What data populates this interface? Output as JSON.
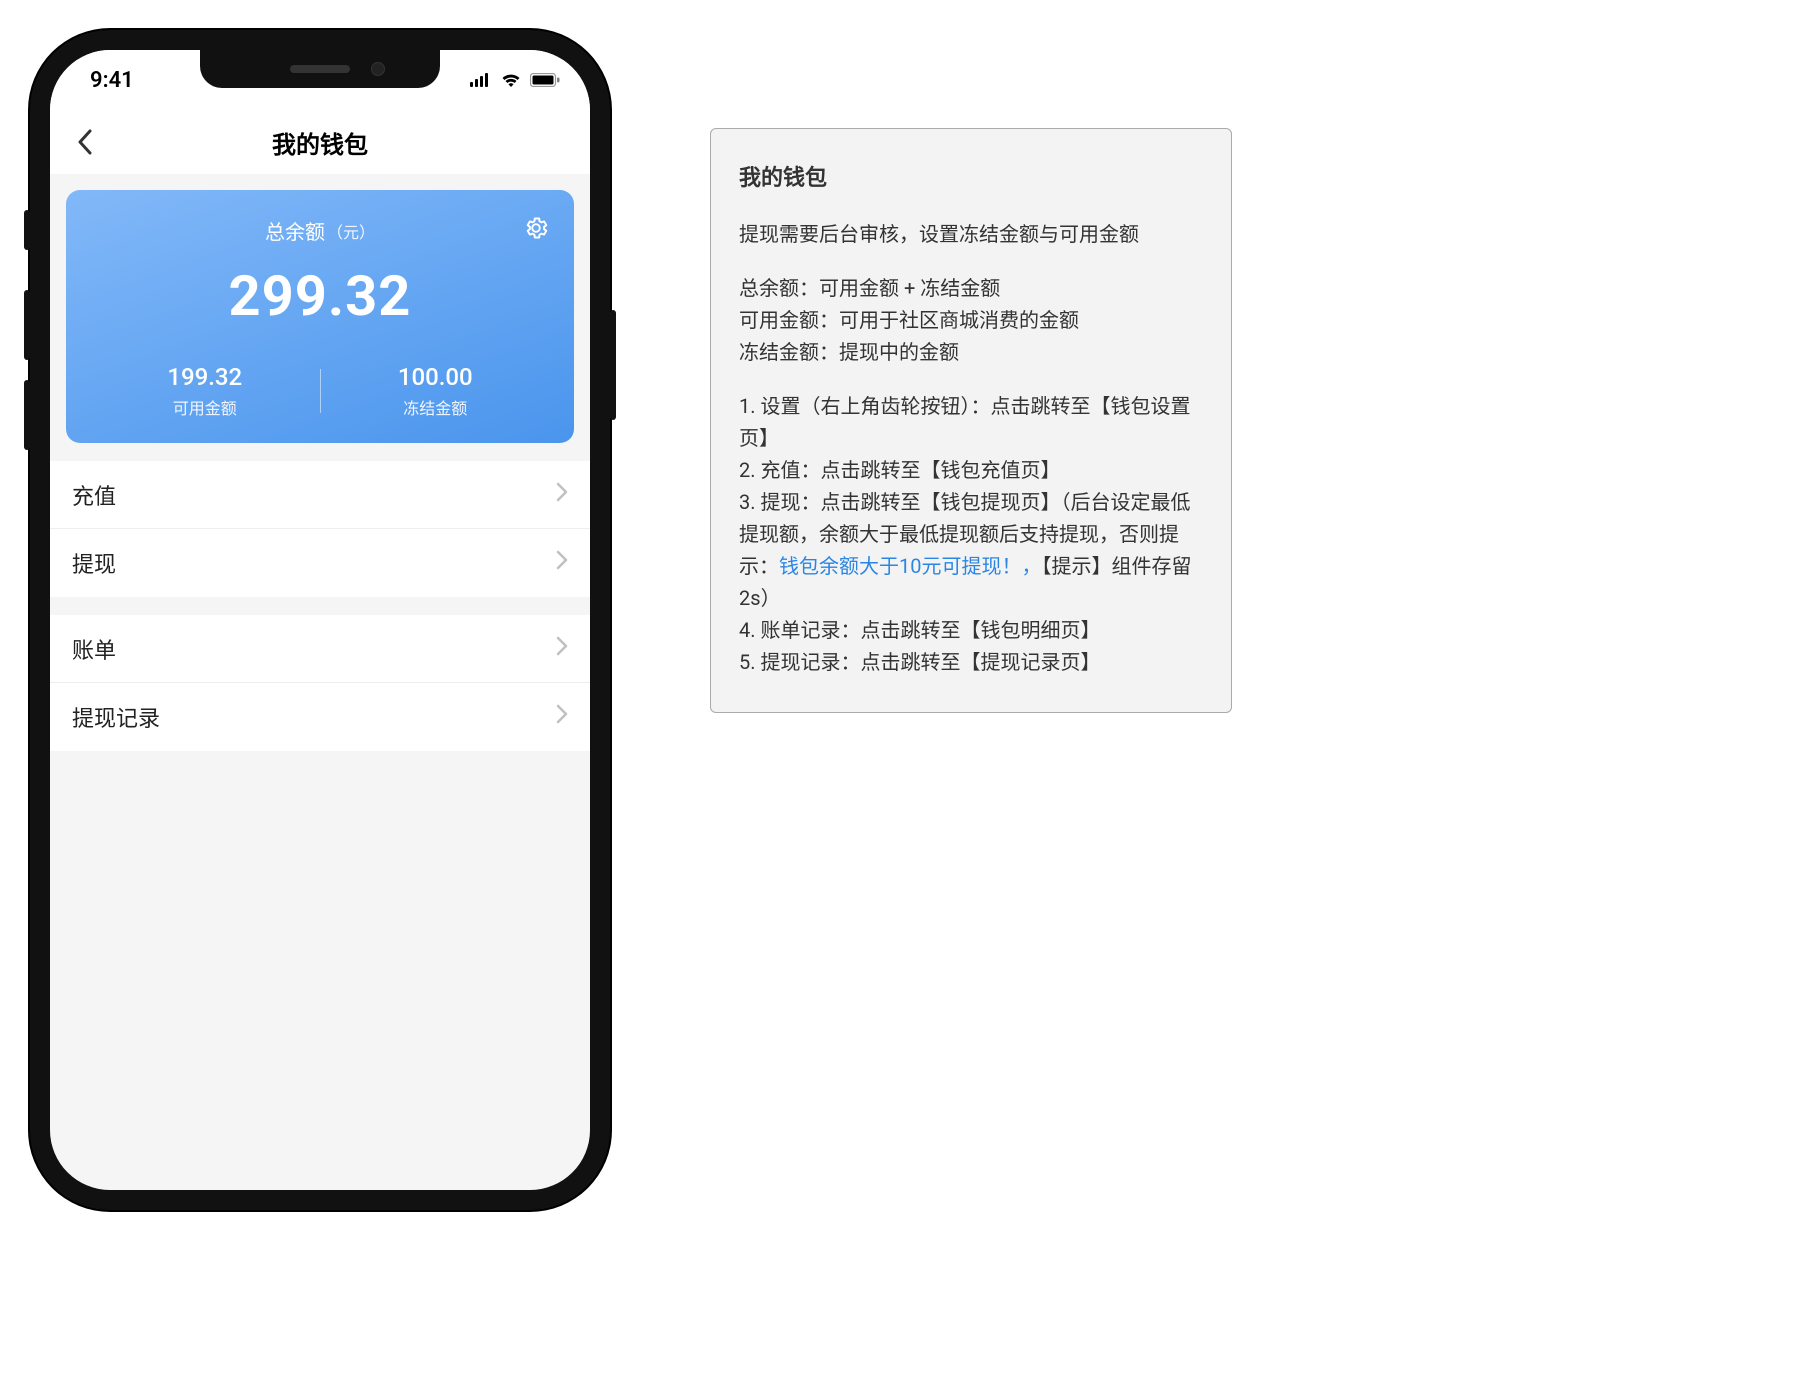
{
  "status_bar": {
    "time": "9:41"
  },
  "nav": {
    "title": "我的钱包"
  },
  "balance_card": {
    "title": "总余额",
    "unit": "（元）",
    "amount": "299.32",
    "available": {
      "value": "199.32",
      "label": "可用金额"
    },
    "frozen": {
      "value": "100.00",
      "label": "冻结金额"
    }
  },
  "list_group_1": [
    {
      "label": "充值"
    },
    {
      "label": "提现"
    }
  ],
  "list_group_2": [
    {
      "label": "账单"
    },
    {
      "label": "提现记录"
    }
  ],
  "annotation": {
    "heading": "我的钱包",
    "intro": "提现需要后台审核，设置冻结金额与可用金额",
    "defs": [
      "总余额：可用金额 + 冻结金额",
      "可用金额：可用于社区商城消费的金额",
      "冻结金额：提现中的金额"
    ],
    "items": [
      "1. 设置（右上角齿轮按钮）：点击跳转至【钱包设置页】",
      "2. 充值：点击跳转至【钱包充值页】",
      "3. 提现：点击跳转至【钱包提现页】（后台设定最低提现额，余额大于最低提现额后支持提现，否则提示：",
      "4. 账单记录：点击跳转至【钱包明细页】",
      "5. 提现记录：点击跳转至【提现记录页】"
    ],
    "tip_link": "钱包余额大于10元可提现！，",
    "tip_suffix": "【提示】组件存留2s）"
  }
}
